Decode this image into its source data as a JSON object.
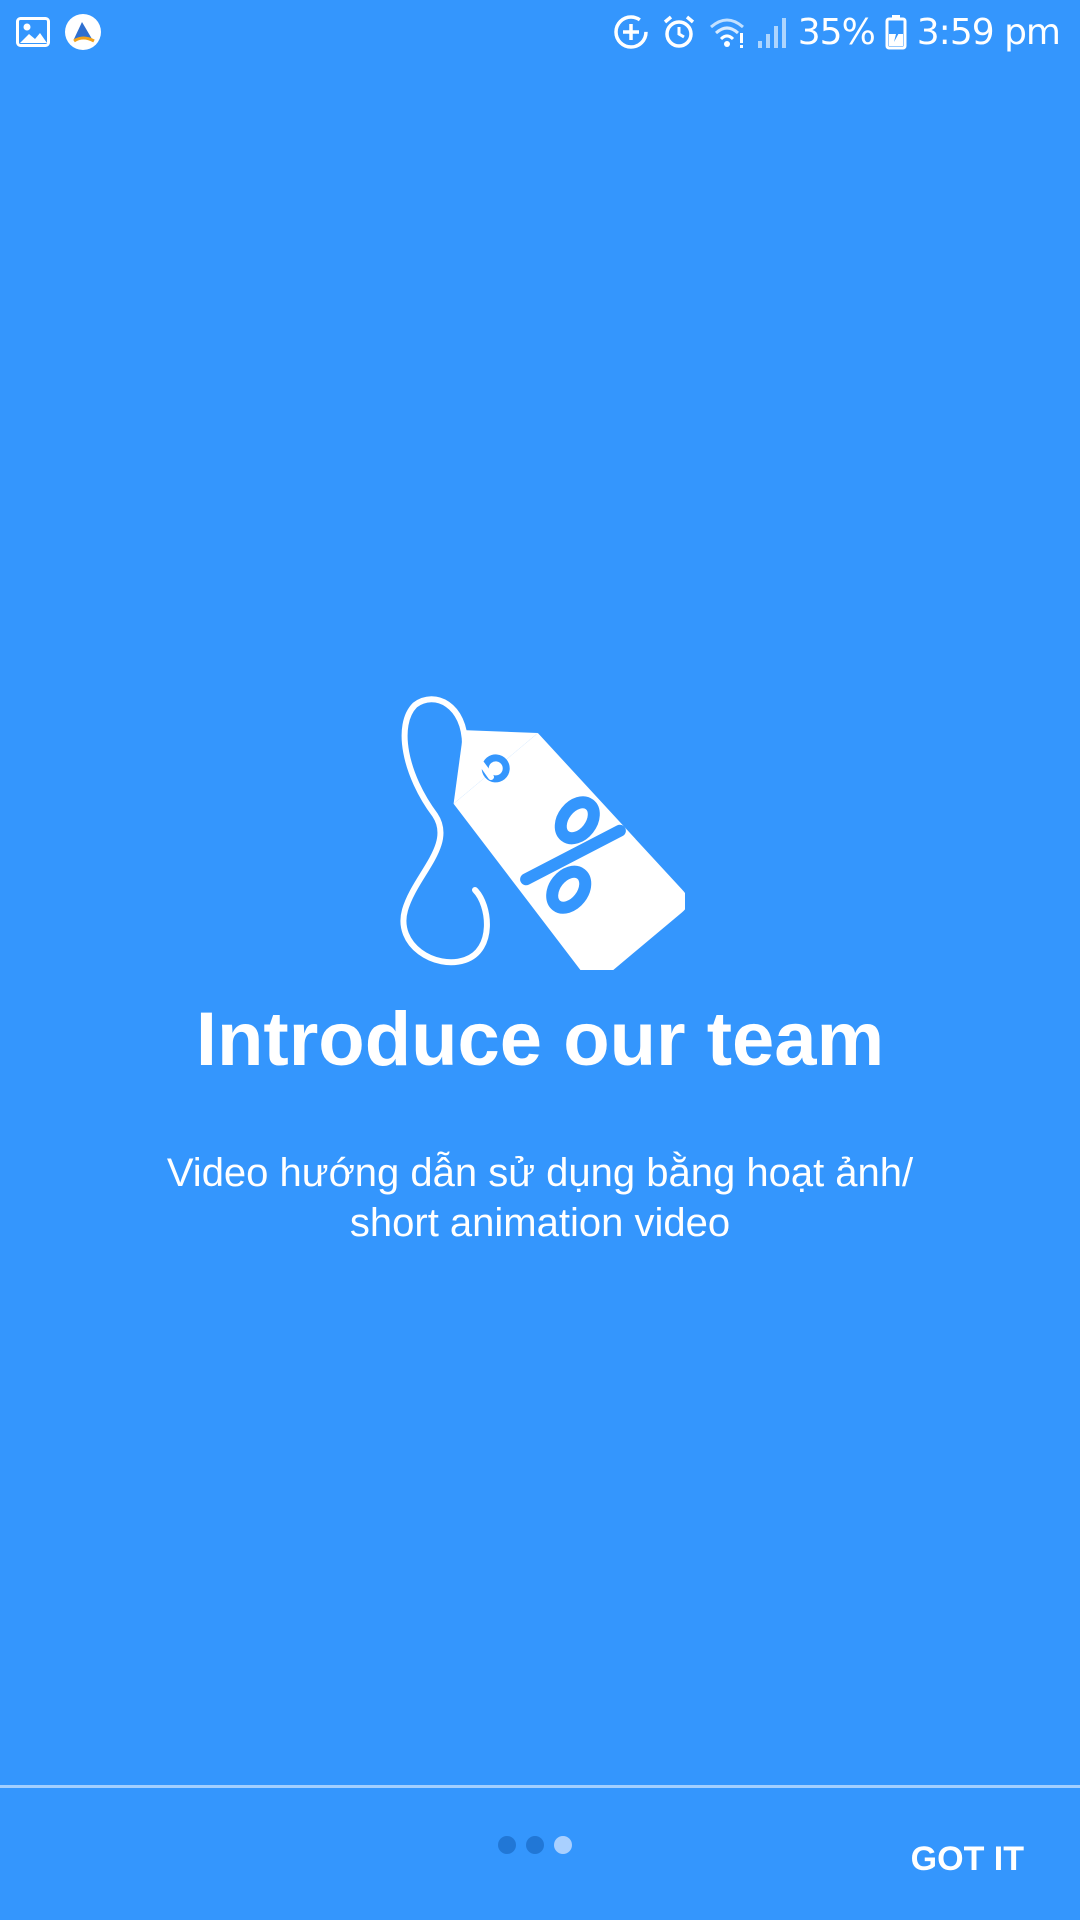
{
  "status_bar": {
    "battery_percent": "35%",
    "time": "3:59 pm",
    "left_icons": [
      "gallery-icon",
      "app-logo-icon"
    ],
    "right_icons": [
      "data-saver-icon",
      "alarm-icon",
      "wifi-icon",
      "signal-icon",
      "battery-charging-icon"
    ]
  },
  "intro": {
    "icon": "discount-tag-icon",
    "title": "Introduce our team",
    "subtitle_line1": "Video hướng dẫn sử dụng bằng hoạt ảnh/",
    "subtitle_line2": "short animation video"
  },
  "footer": {
    "page_count": 3,
    "active_page": 3,
    "got_it_label": "GOT IT"
  },
  "colors": {
    "background": "#3496FD",
    "dot_inactive": "#2177D6",
    "dot_active": "#A9D0FF"
  }
}
